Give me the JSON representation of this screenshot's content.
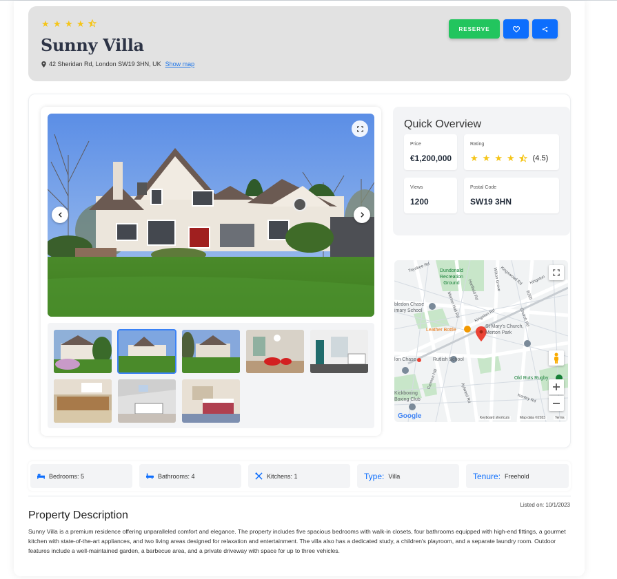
{
  "header": {
    "rating_stars": 4.5,
    "title": "Sunny Villa",
    "address": "42 Sheridan Rd, London SW19 3HN, UK",
    "show_map_label": "Show map",
    "reserve_label": "RESERVE",
    "favorite_icon": "heart-icon",
    "share_icon": "share-icon"
  },
  "overview": {
    "title": "Quick Overview",
    "price_label": "Price",
    "price_value": "€1,200,000",
    "rating_label": "Rating",
    "rating_value": "(4.5)",
    "views_label": "Views",
    "views_value": "1200",
    "postal_label": "Postal Code",
    "postal_value": "SW19 3HN"
  },
  "gallery": {
    "thumbnail_count": 8,
    "active_thumbnail": 2
  },
  "map": {
    "labels": {
      "recreation": "Dundonald\nRecreation\nGround",
      "school1": "bledon Chase\nimary School",
      "leather": "Leather Bottle",
      "church": "St Mary's Church,\nMerton Park",
      "rutlish": "Rutlish School",
      "chase": "lon Chase",
      "ruts": "Old Ruts Rugby",
      "kickboxing": "Kickboxing\nBoxing Club",
      "kingston_rd": "Kingston Rd",
      "kingswood": "Kingswood Rd",
      "road_b285": "B285",
      "toynbee": "Toynbee Rd",
      "hartfield": "Hartfield Rd",
      "merton_hall": "Merton Hall Rd",
      "church_rd": "Church Rd",
      "wilton": "Wilton Grove",
      "kenley": "Kenley Rd",
      "aylward": "Aylward Rd",
      "cannon": "Cannon Hill",
      "kingston_short": "Kingsto",
      "ks_side": "Kingston"
    },
    "footer": {
      "google": "Google",
      "shortcuts": "Keyboard shortcuts",
      "mapdata": "Map data ©2023",
      "terms": "Terms"
    }
  },
  "features": [
    {
      "icon": "bed-icon",
      "text": "Bedrooms: 5"
    },
    {
      "icon": "bath-icon",
      "text": "Bathrooms: 4"
    },
    {
      "icon": "utensils-icon",
      "text": "Kitchens: 1"
    },
    {
      "key": "Type:",
      "text": "Villa"
    },
    {
      "key": "Tenure:",
      "text": "Freehold"
    }
  ],
  "listed_on": "Listed on: 10/1/2023",
  "description": {
    "title": "Property Description",
    "text": "Sunny Villa is a premium residence offering unparalleled comfort and elegance. The property includes five spacious bedrooms with walk-in closets, four bathrooms equipped with high-end fittings, a gourmet kitchen with state-of-the-art appliances, and two living areas designed for relaxation and entertainment. The villa also has a dedicated study, a children's playroom, and a separate laundry room. Outdoor features include a well-maintained garden, a barbecue area, and a private driveway with space for up to three vehicles."
  }
}
